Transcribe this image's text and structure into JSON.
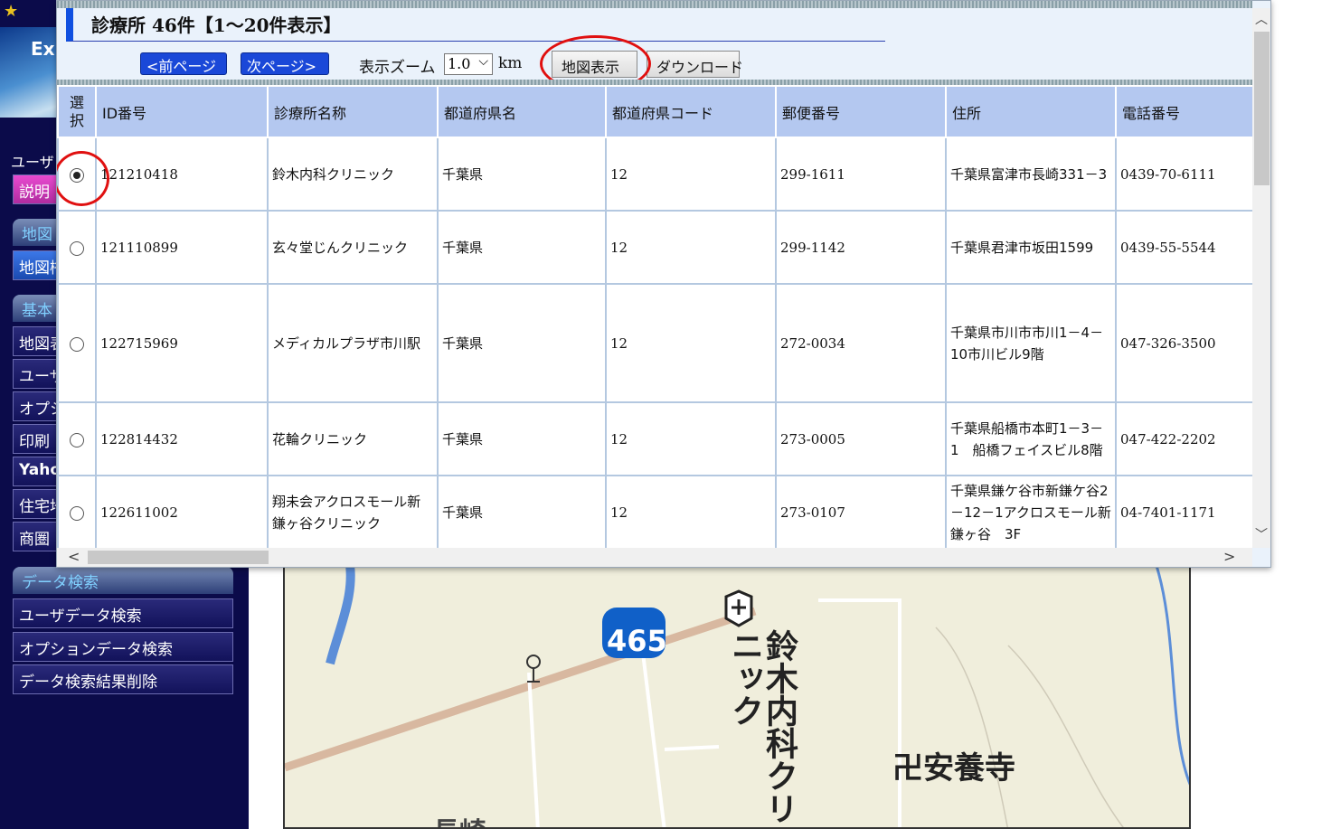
{
  "sidebar": {
    "banner_text": "Ex",
    "user_label": "ユーザ",
    "items": [
      {
        "label": "説明"
      },
      {
        "label": "地図"
      },
      {
        "label": "地図桁"
      },
      {
        "label": "基本"
      },
      {
        "label": "地図表"
      },
      {
        "label": "ユーザ"
      },
      {
        "label": "オプシ"
      },
      {
        "label": "印刷"
      },
      {
        "label": "Yaho"
      },
      {
        "label": "住宅地"
      },
      {
        "label": "商圏"
      }
    ],
    "data_search": {
      "heading": "データ検索",
      "items": [
        {
          "label": "ユーザデータ検索"
        },
        {
          "label": "オプションデータ検索"
        },
        {
          "label": "データ検索結果削除"
        }
      ]
    }
  },
  "popup": {
    "title": "診療所 46件【1～20件表示】",
    "prev_label": "<前ページ",
    "next_label": "次ページ>",
    "zoom_label": "表示ズーム",
    "zoom_value": "1.0",
    "zoom_unit": "km",
    "map_button": "地図表示",
    "download_button": "ダウンロード",
    "columns": [
      "選択",
      "ID番号",
      "診療所名称",
      "都道府県名",
      "都道府県コード",
      "郵便番号",
      "住所",
      "電話番号"
    ],
    "rows": [
      {
        "selected": true,
        "id": "121210418",
        "name": "鈴木内科クリニック",
        "pref": "千葉県",
        "code": "12",
        "zip": "299-1611",
        "address": "千葉県富津市長崎331－3",
        "phone": "0439-70-6111"
      },
      {
        "selected": false,
        "id": "121110899",
        "name": "玄々堂じんクリニック",
        "pref": "千葉県",
        "code": "12",
        "zip": "299-1142",
        "address": "千葉県君津市坂田1599",
        "phone": "0439-55-5544"
      },
      {
        "selected": false,
        "id": "122715969",
        "name": "メディカルプラザ市川駅",
        "pref": "千葉県",
        "code": "12",
        "zip": "272-0034",
        "address": "千葉県市川市市川1－4－10市川ビル9階",
        "phone": "047-326-3500"
      },
      {
        "selected": false,
        "id": "122814432",
        "name": "花輪クリニック",
        "pref": "千葉県",
        "code": "12",
        "zip": "273-0005",
        "address": "千葉県船橋市本町1－3－1　船橋フェイスビル8階",
        "phone": "047-422-2202"
      },
      {
        "selected": false,
        "id": "122611002",
        "name": "翔未会アクロスモール新鎌ヶ谷クリニック",
        "pref": "千葉県",
        "code": "12",
        "zip": "273-0107",
        "address": "千葉県鎌ケ谷市新鎌ケ谷2－12－1アクロスモール新鎌ヶ谷　3F",
        "phone": "04-7401-1171"
      }
    ]
  },
  "map": {
    "route_number": "465",
    "clinic_label": "鈴木内科クリニック",
    "temple_label": "卍安養寺",
    "partial_place": "長崎",
    "road_color": "#d8b8a0",
    "river_color": "#5c8ed8",
    "route_shield_color": "#1060c8"
  }
}
